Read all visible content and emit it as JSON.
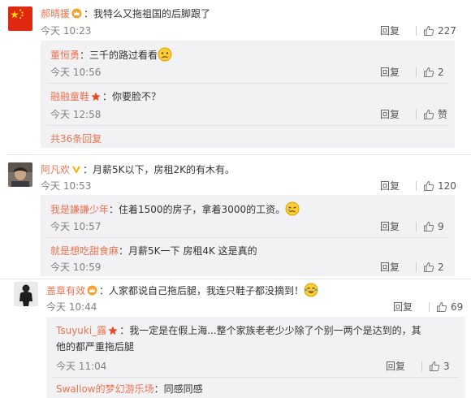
{
  "c1": {
    "user": "郝晴援",
    "text": "：我特么又拖祖国的后脚跟了",
    "time": "今天 10:23",
    "reply": "回复",
    "likes": "227",
    "subs": [
      {
        "user": "董恒勇",
        "text": "：三千的路过看看",
        "time": "今天 10:56",
        "reply": "回复",
        "likes": "2"
      },
      {
        "user": "融融童鞋",
        "text": "：你要脸不？",
        "time": "今天 12:58",
        "reply": "回复",
        "likes": "赞"
      }
    ],
    "more": "共36条回复"
  },
  "c2": {
    "user": "阿凡欢",
    "text": "：月薪5K以下，房租2K的有木有。",
    "time": "今天 10:53",
    "reply": "回复",
    "likes": "120",
    "subs": [
      {
        "user": "我是謙謙少年",
        "text": "：住着1500的房子，拿着3000的工资。",
        "time": "今天 10:57",
        "reply": "回复",
        "likes": "9"
      },
      {
        "user": "就是想吃甜食麻",
        "text": "：月薪5K一下 房租4K 这是真的",
        "time": "今天 10:59",
        "reply": "回复",
        "likes": "2"
      }
    ]
  },
  "c3": {
    "user": "盖章有效",
    "text": "：人家都说自己拖后腿，我连只鞋子都没摘到！",
    "time": "今天 10:44",
    "reply": "回复",
    "likes": "69",
    "subs": [
      {
        "user": "Tsuyuki_露",
        "text": "：我一定是在假上海...整个家族老老少少除了个别一两个是达到的，其",
        "text2": "他的都严重拖后腿",
        "time": "今天 11:04",
        "reply": "回复",
        "likes": "3"
      },
      {
        "user": "Swallow的梦幻游乐场",
        "text": "：同感同感"
      }
    ]
  }
}
